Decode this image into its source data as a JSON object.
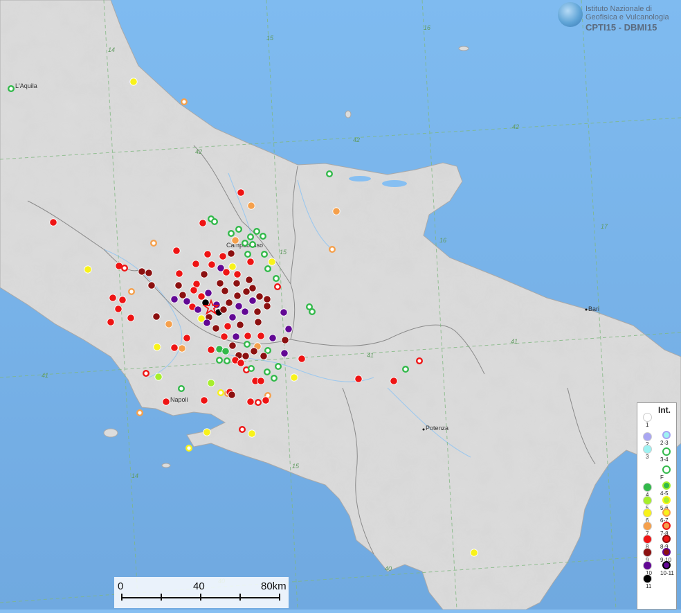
{
  "header": {
    "line1": "Istituto Nazionale di",
    "line2": "Geofisica e Vulcanologia",
    "title": "CPTI15 - DBMI15"
  },
  "places": {
    "laquila": "L'Aquila",
    "campobasso": "Campobasso",
    "bari": "Bari",
    "napoli": "Napoli",
    "potenza": "Potenza"
  },
  "grid_labels": {
    "lon14": "14",
    "lon15": "15",
    "lon16": "16",
    "lon17": "17",
    "lat42": "42",
    "lat41": "41",
    "lat40": "40"
  },
  "legend": {
    "title": "Int.",
    "labels": [
      "1",
      "2",
      "3",
      "4",
      "5",
      "6",
      "7",
      "8",
      "9",
      "10",
      "11",
      "2-3",
      "3-4",
      "F",
      "4-5",
      "5-6",
      "6-7",
      "7-8",
      "8-9",
      "9-10",
      "10-11"
    ],
    "colors": {
      "i1": "#ffffff",
      "i2": "#a9a6f2",
      "i3": "#9ef2f2",
      "i4": "#32b94a",
      "i5": "#a6ee2c",
      "i6": "#f8f21a",
      "i7": "#f5a04c",
      "i8": "#ee1414",
      "i9": "#8b1010",
      "i10": "#620894",
      "i11": "#000000"
    }
  },
  "scale": {
    "labels": [
      "0",
      "40",
      "80km"
    ]
  },
  "epicenter": "star-icon"
}
